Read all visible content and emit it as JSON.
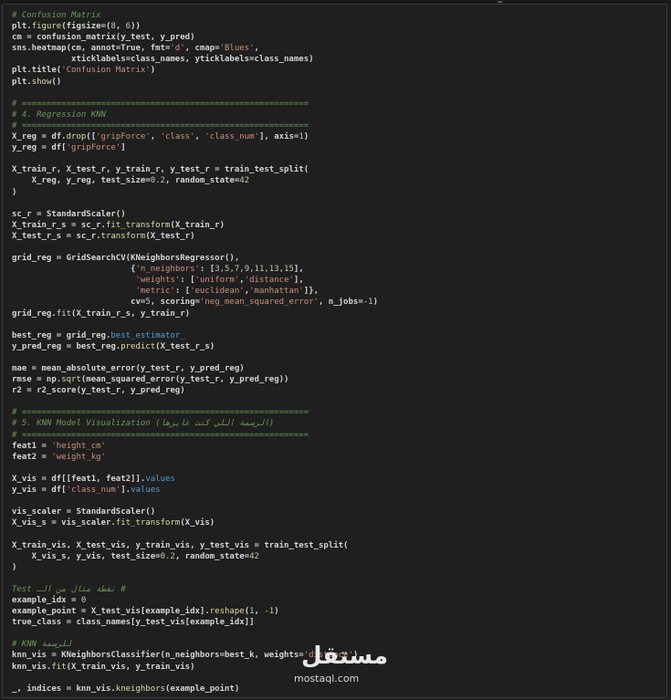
{
  "editor": {
    "lines": [
      [
        [
          "# Confusion Matrix",
          "com"
        ]
      ],
      [
        [
          "plt.",
          "plain"
        ],
        [
          "figure",
          "fn"
        ],
        [
          "(figsize=(",
          "plain"
        ],
        [
          "8",
          "num"
        ],
        [
          ", ",
          "plain"
        ],
        [
          "6",
          "num"
        ],
        [
          "))",
          "plain"
        ]
      ],
      [
        [
          "cm = confusion_matrix(y_test, y_pred)",
          "plain"
        ]
      ],
      [
        [
          "sns.heatmap(cm, annot=True, fmt=",
          "plain"
        ],
        [
          "'d'",
          "str"
        ],
        [
          ", cmap=",
          "plain"
        ],
        [
          "'Blues'",
          "str"
        ],
        [
          ",",
          "plain"
        ]
      ],
      [
        [
          "            xticklabels=class_names, yticklabels=class_names)",
          "plain"
        ]
      ],
      [
        [
          "plt.title(",
          "plain"
        ],
        [
          "'Confusion Matrix'",
          "str"
        ],
        [
          ")",
          "plain"
        ]
      ],
      [
        [
          "plt.",
          "plain"
        ],
        [
          "show",
          "fn"
        ],
        [
          "()",
          "plain"
        ]
      ],
      [
        [
          "",
          "plain"
        ]
      ],
      [
        [
          "# ==========================================================",
          "com"
        ]
      ],
      [
        [
          "# 4. Regression KNN",
          "com"
        ]
      ],
      [
        [
          "# ==========================================================",
          "com"
        ]
      ],
      [
        [
          "X_reg = df.",
          "plain"
        ],
        [
          "drop",
          "fn"
        ],
        [
          "([",
          "plain"
        ],
        [
          "'gripForce'",
          "str"
        ],
        [
          ", ",
          "plain"
        ],
        [
          "'class'",
          "str"
        ],
        [
          ", ",
          "plain"
        ],
        [
          "'class_num'",
          "str"
        ],
        [
          "], axis=",
          "plain"
        ],
        [
          "1",
          "num"
        ],
        [
          ")",
          "plain"
        ]
      ],
      [
        [
          "y_reg = df[",
          "plain"
        ],
        [
          "'gripForce'",
          "str"
        ],
        [
          "]",
          "plain"
        ]
      ],
      [
        [
          "",
          "plain"
        ]
      ],
      [
        [
          "X_train_r, X_test_r, y_train_r, y_test_r = train_test_split(",
          "plain"
        ]
      ],
      [
        [
          "    X_reg, y_reg, test_size=",
          "plain"
        ],
        [
          "0.2",
          "num"
        ],
        [
          ", random_state=",
          "plain"
        ],
        [
          "42",
          "num"
        ]
      ],
      [
        [
          ")",
          "plain"
        ]
      ],
      [
        [
          "",
          "plain"
        ]
      ],
      [
        [
          "sc_r = StandardScaler()",
          "plain"
        ]
      ],
      [
        [
          "X_train_r_s = sc_r.",
          "plain"
        ],
        [
          "fit_transform",
          "fn"
        ],
        [
          "(X_train_r)",
          "plain"
        ]
      ],
      [
        [
          "X_test_r_s = sc_r.",
          "plain"
        ],
        [
          "transform",
          "fn"
        ],
        [
          "(X_test_r)",
          "plain"
        ]
      ],
      [
        [
          "",
          "plain"
        ]
      ],
      [
        [
          "grid_reg = GridSearchCV(KNeighborsRegressor(),",
          "plain"
        ]
      ],
      [
        [
          "                        {",
          "plain"
        ],
        [
          "'n_neighbors'",
          "str"
        ],
        [
          ": [",
          "plain"
        ],
        [
          "3,5,7,9,11,13,15",
          "num"
        ],
        [
          "],",
          "plain"
        ]
      ],
      [
        [
          "                         ",
          "plain"
        ],
        [
          "'weights'",
          "str"
        ],
        [
          ": [",
          "plain"
        ],
        [
          "'uniform'",
          "str"
        ],
        [
          ",",
          "plain"
        ],
        [
          "'distance'",
          "str"
        ],
        [
          "],",
          "plain"
        ]
      ],
      [
        [
          "                         ",
          "plain"
        ],
        [
          "'metric'",
          "str"
        ],
        [
          ": [",
          "plain"
        ],
        [
          "'euclidean'",
          "str"
        ],
        [
          ",",
          "plain"
        ],
        [
          "'manhattan'",
          "str"
        ],
        [
          "]},",
          "plain"
        ]
      ],
      [
        [
          "                        cv=",
          "plain"
        ],
        [
          "5",
          "num"
        ],
        [
          ", scoring=",
          "plain"
        ],
        [
          "'neg_mean_squared_error'",
          "str"
        ],
        [
          ", n_jobs=",
          "plain"
        ],
        [
          "-1",
          "num"
        ],
        [
          ")",
          "plain"
        ]
      ],
      [
        [
          "grid_reg.",
          "plain"
        ],
        [
          "fit",
          "fn"
        ],
        [
          "(X_train_r_s, y_train_r)",
          "plain"
        ]
      ],
      [
        [
          "",
          "plain"
        ]
      ],
      [
        [
          "best_reg = grid_reg.",
          "plain"
        ],
        [
          "best_estimator_",
          "kw"
        ]
      ],
      [
        [
          "y_pred_reg = best_reg.",
          "plain"
        ],
        [
          "predict",
          "fn"
        ],
        [
          "(X_test_r_s)",
          "plain"
        ]
      ],
      [
        [
          "",
          "plain"
        ]
      ],
      [
        [
          "mae = mean_absolute_error(y_test_r, y_pred_reg)",
          "plain"
        ]
      ],
      [
        [
          "rmse = np.",
          "plain"
        ],
        [
          "sqrt",
          "fn"
        ],
        [
          "(mean_squared_error(y_test_r, y_pred_reg))",
          "plain"
        ]
      ],
      [
        [
          "r2 = r2_score(y_test_r, y_pred_reg)",
          "plain"
        ]
      ],
      [
        [
          "",
          "plain"
        ]
      ],
      [
        [
          "# ==========================================================",
          "com"
        ]
      ],
      [
        [
          "# 5. KNN Model Visualization (الرسمة اللي كنت عايزها)",
          "com"
        ]
      ],
      [
        [
          "# ==========================================================",
          "com"
        ]
      ],
      [
        [
          "feat1 = ",
          "plain"
        ],
        [
          "'height_cm'",
          "str"
        ]
      ],
      [
        [
          "feat2 = ",
          "plain"
        ],
        [
          "'weight_kg'",
          "str"
        ]
      ],
      [
        [
          "",
          "plain"
        ]
      ],
      [
        [
          "X_vis = df[[feat1, feat2]].",
          "plain"
        ],
        [
          "values",
          "kw"
        ]
      ],
      [
        [
          "y_vis = df[",
          "plain"
        ],
        [
          "'class_num'",
          "str"
        ],
        [
          "].",
          "plain"
        ],
        [
          "values",
          "kw"
        ]
      ],
      [
        [
          "",
          "plain"
        ]
      ],
      [
        [
          "vis_scaler = StandardScaler()",
          "plain"
        ]
      ],
      [
        [
          "X_vis_s = vis_scaler.",
          "plain"
        ],
        [
          "fit_transform",
          "fn"
        ],
        [
          "(X_vis)",
          "plain"
        ]
      ],
      [
        [
          "",
          "plain"
        ]
      ],
      [
        [
          "X_train_vis, X_test_vis, y_train_vis, y_test_vis = train_test_split(",
          "plain"
        ]
      ],
      [
        [
          "    X_vis_s, y_vis, test_size=",
          "plain"
        ],
        [
          "0.2",
          "num"
        ],
        [
          ", random_state=",
          "plain"
        ],
        [
          "42",
          "num"
        ]
      ],
      [
        [
          ")",
          "plain"
        ]
      ],
      [
        [
          "",
          "plain"
        ]
      ],
      [
        [
          "# نقطة مثال من الـ Test",
          "com"
        ]
      ],
      [
        [
          "example_idx = ",
          "plain"
        ],
        [
          "0",
          "num"
        ]
      ],
      [
        [
          "example_point = X_test_vis[example_idx].",
          "plain"
        ],
        [
          "reshape",
          "fn"
        ],
        [
          "(",
          "plain"
        ],
        [
          "1",
          "num"
        ],
        [
          ", ",
          "plain"
        ],
        [
          "-1",
          "num"
        ],
        [
          ")",
          "plain"
        ]
      ],
      [
        [
          "true_class = class_names[y_test_vis[example_idx]]",
          "plain"
        ]
      ],
      [
        [
          "",
          "plain"
        ]
      ],
      [
        [
          "# KNN للرسمة",
          "com"
        ]
      ],
      [
        [
          "knn_vis = KNeighborsClassifier(n_neighbors=best_k, weights=",
          "plain"
        ],
        [
          "'distance'",
          "str"
        ],
        [
          ")",
          "plain"
        ]
      ],
      [
        [
          "knn_vis.",
          "plain"
        ],
        [
          "fit",
          "fn"
        ],
        [
          "(X_train_vis, y_train_vis)",
          "plain"
        ]
      ],
      [
        [
          "",
          "plain"
        ]
      ],
      [
        [
          "_, indices = knn_vis.",
          "plain"
        ],
        [
          "kneighbors",
          "fn"
        ],
        [
          "(example_point)",
          "plain"
        ]
      ]
    ]
  },
  "watermark": {
    "logo_text": "مستقل",
    "url_text": "mostaql.com"
  }
}
